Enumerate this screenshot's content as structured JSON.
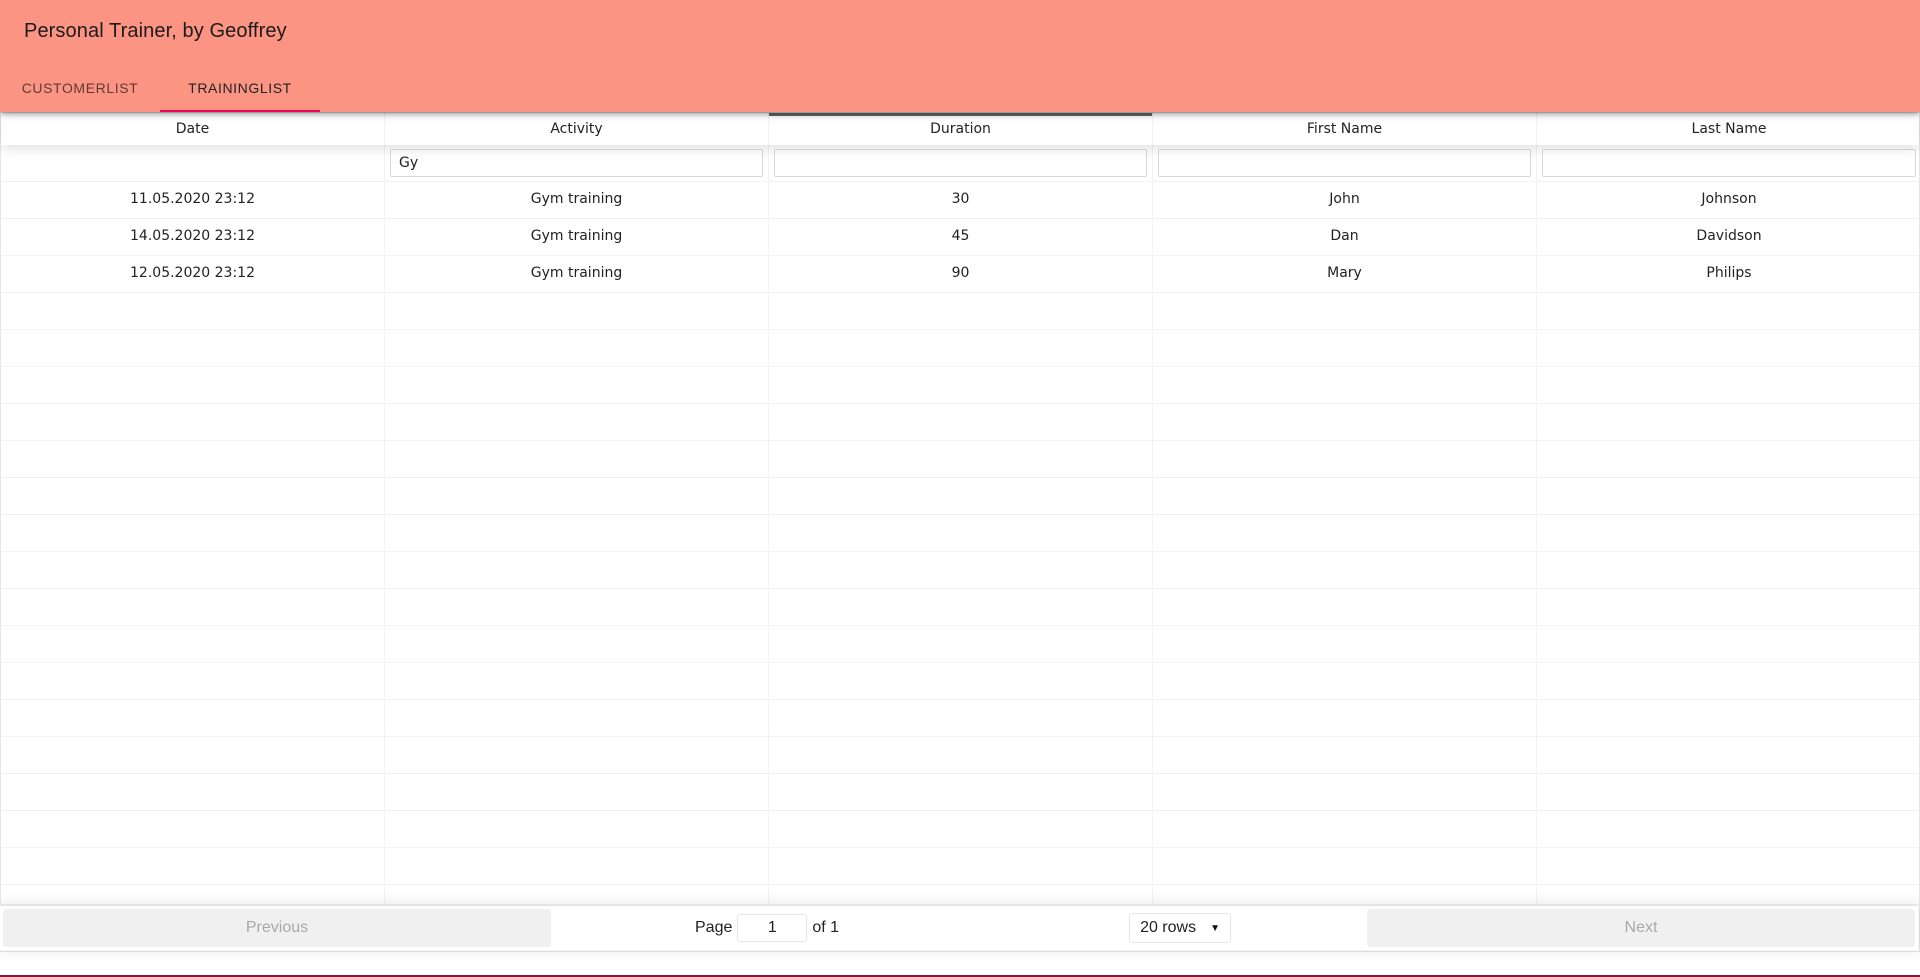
{
  "app": {
    "title": "Personal Trainer, by Geoffrey"
  },
  "tabs": [
    {
      "label": "CUSTOMERLIST",
      "active": false
    },
    {
      "label": "TRAININGLIST",
      "active": true
    }
  ],
  "table": {
    "columns": [
      "Date",
      "Activity",
      "Duration",
      "First Name",
      "Last Name"
    ],
    "sorted_column": "Duration",
    "filters": [
      "",
      "Gy",
      "",
      "",
      ""
    ],
    "rows": [
      [
        "11.05.2020 23:12",
        "Gym training",
        "30",
        "John",
        "Johnson"
      ],
      [
        "14.05.2020 23:12",
        "Gym training",
        "45",
        "Dan",
        "Davidson"
      ],
      [
        "12.05.2020 23:12",
        "Gym training",
        "90",
        "Mary",
        "Philips"
      ]
    ]
  },
  "pagination": {
    "previous_label": "Previous",
    "next_label": "Next",
    "page_label": "Page",
    "current_page": "1",
    "of_label": "of 1",
    "rows_option": "20 rows"
  },
  "colors": {
    "appbar": "#fb9483",
    "tab_indicator": "#f50057"
  }
}
